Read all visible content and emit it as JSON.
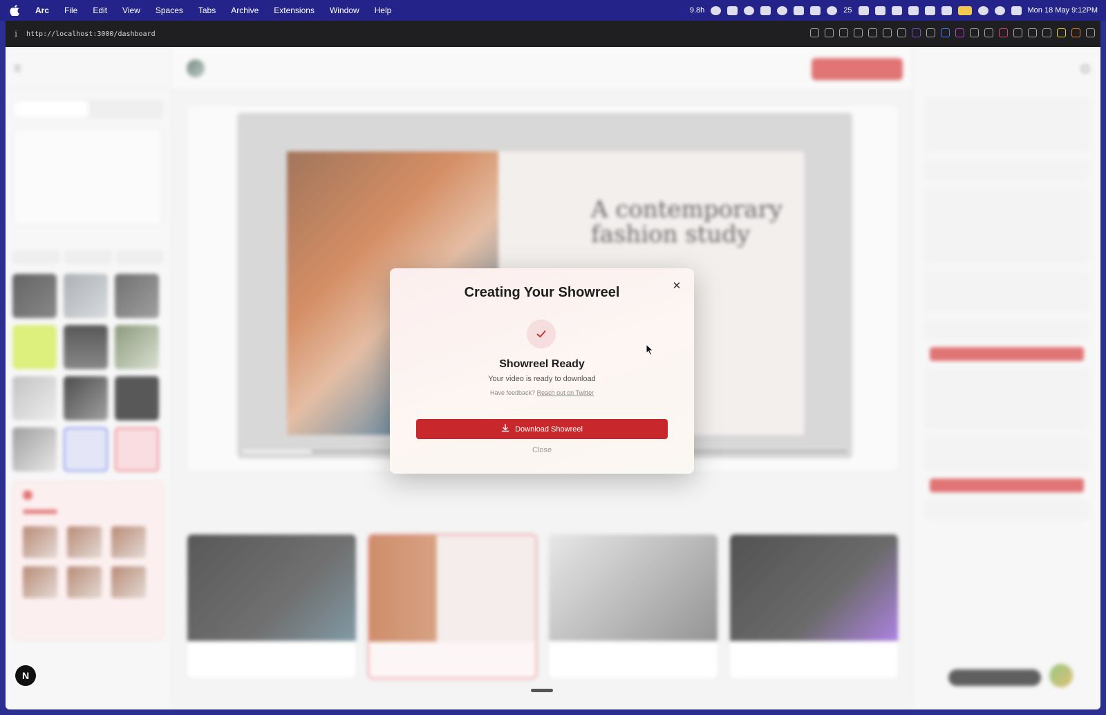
{
  "menubar": {
    "app_name": "Arc",
    "items": [
      "File",
      "Edit",
      "View",
      "Spaces",
      "Tabs",
      "Archive",
      "Extensions",
      "Window",
      "Help"
    ],
    "battery_text": "9.8h",
    "github_count": "25",
    "datetime": "Mon 18 May  9:12PM"
  },
  "browser": {
    "url": "http://localhost:3000/dashboard"
  },
  "modal": {
    "title": "Creating Your Showreel",
    "status_title": "Showreel Ready",
    "status_subtitle": "Your video is ready to download",
    "feedback_prefix": "Have feedback?",
    "feedback_link": "Reach out on Twitter",
    "download_label": "Download Showreel",
    "close_label": "Close",
    "close_icon": "✕"
  },
  "background": {
    "preview_title": "A contemporary fashion study"
  },
  "colors": {
    "accent_red": "#c8282c",
    "menubar_bg": "#23238a"
  }
}
